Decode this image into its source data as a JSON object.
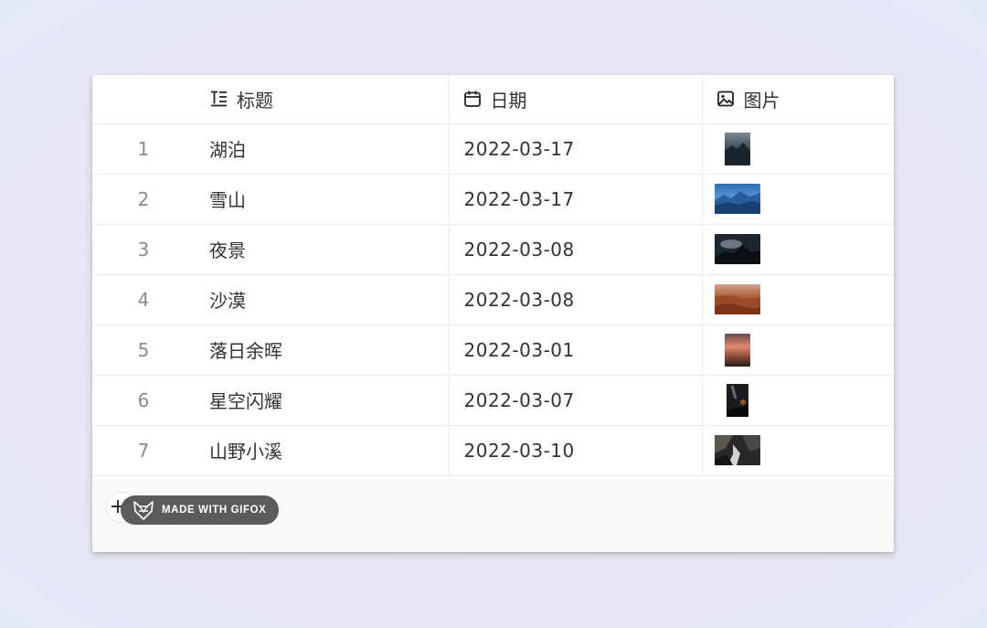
{
  "header": {
    "title_col": {
      "label": "标题",
      "icon": "text-icon"
    },
    "date_col": {
      "label": "日期",
      "icon": "calendar-icon"
    },
    "image_col": {
      "label": "图片",
      "icon": "image-icon"
    }
  },
  "rows": [
    {
      "num": "1",
      "title": "湖泊",
      "date": "2022-03-17",
      "thumb": "lake-photo"
    },
    {
      "num": "2",
      "title": "雪山",
      "date": "2022-03-17",
      "thumb": "snow-mountain-photo"
    },
    {
      "num": "3",
      "title": "夜景",
      "date": "2022-03-08",
      "thumb": "night-scene-photo"
    },
    {
      "num": "4",
      "title": "沙漠",
      "date": "2022-03-08",
      "thumb": "desert-photo"
    },
    {
      "num": "5",
      "title": "落日余晖",
      "date": "2022-03-01",
      "thumb": "sunset-photo"
    },
    {
      "num": "6",
      "title": "星空闪耀",
      "date": "2022-03-07",
      "thumb": "starry-sky-photo"
    },
    {
      "num": "7",
      "title": "山野小溪",
      "date": "2022-03-10",
      "thumb": "mountain-stream-photo"
    }
  ],
  "footer": {
    "add_label": "+",
    "badge_text": "MADE WITH GIFOX",
    "badge_icon": "fox-logo-icon"
  },
  "colors": {
    "background_start": "#efe2f0",
    "background_end": "#e3e8f7",
    "text": "#333333",
    "row_number": "#8a8a8a",
    "grid_line": "#ececec",
    "badge_bg": "#5b5b5b"
  }
}
